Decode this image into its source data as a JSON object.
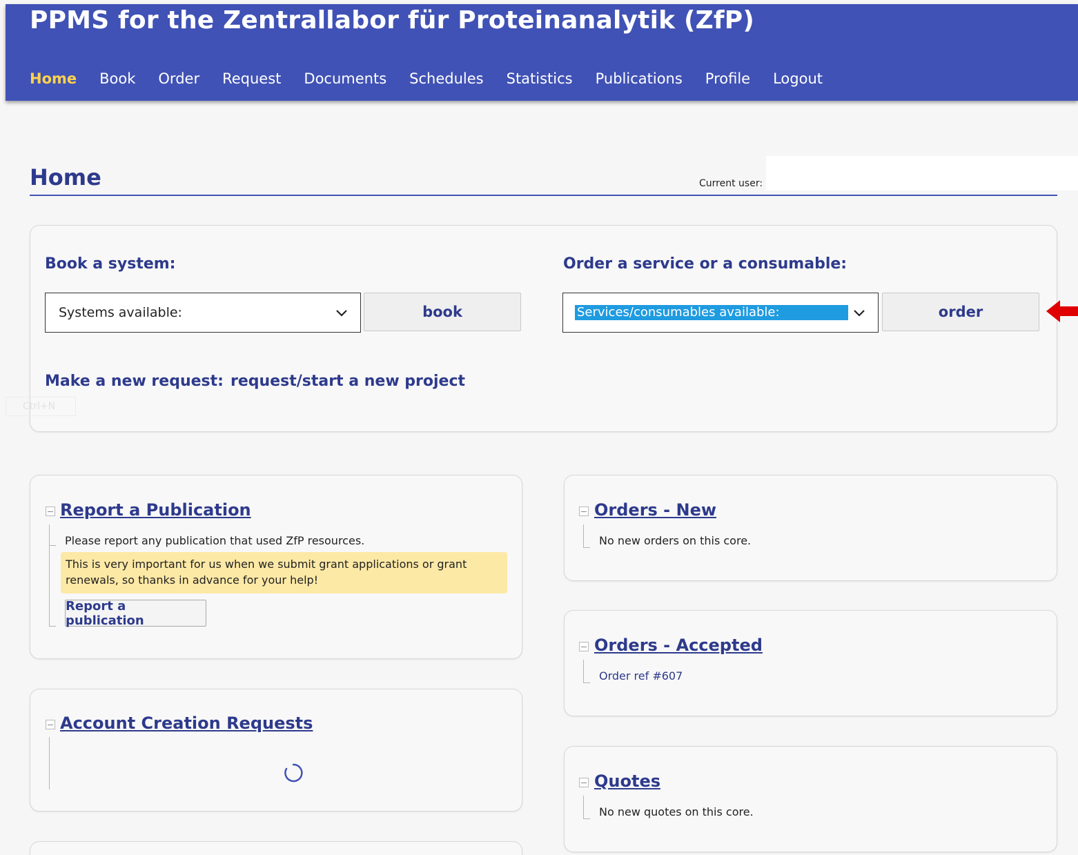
{
  "header": {
    "title": "PPMS for the Zentrallabor für Proteinanalytik (ZfP)",
    "nav": [
      {
        "label": "Home",
        "active": true
      },
      {
        "label": "Book"
      },
      {
        "label": "Order"
      },
      {
        "label": "Request"
      },
      {
        "label": "Documents"
      },
      {
        "label": "Schedules"
      },
      {
        "label": "Statistics"
      },
      {
        "label": "Publications"
      },
      {
        "label": "Profile"
      },
      {
        "label": "Logout"
      }
    ]
  },
  "page": {
    "title": "Home",
    "current_user_label": "Current user:"
  },
  "book": {
    "label": "Book a system:",
    "select_value": "Systems available:",
    "button_label": "book"
  },
  "order": {
    "label": "Order a service or a consumable:",
    "select_value": "Services/consumables available:",
    "button_label": "order"
  },
  "request": {
    "label": "Make a new request:",
    "link": "request/start a new project"
  },
  "ghost_hint": "Ctrl+N",
  "widgets": {
    "report_publication": {
      "title": "Report a Publication",
      "text": "Please report any publication that used ZfP resources.",
      "notice_line1": "This is very important for us when we submit grant applications or grant",
      "notice_line2": "renewals, so thanks in advance for your help!",
      "button_label": "Report a publication"
    },
    "account_creation": {
      "title": "Account Creation Requests"
    },
    "orders_new": {
      "title": "Orders - New",
      "text": "No new orders on this core."
    },
    "orders_accepted": {
      "title": "Orders - Accepted",
      "item": "Order ref #607"
    },
    "quotes": {
      "title": "Quotes",
      "text": "No new quotes on this core."
    }
  },
  "colors": {
    "header_bg": "#4052b5",
    "nav_active": "#ffd24d",
    "accent_text": "#2d3a8c",
    "selection_highlight": "#1f9be0",
    "notice_bg": "#fde9a6",
    "arrow": "#e00000"
  },
  "icons": {
    "select_chevron": "chevron-down-icon",
    "pointer_arrow": "red-arrow-left-icon",
    "loading": "loading-spinner-icon",
    "collapse": "collapse-minus-icon"
  }
}
